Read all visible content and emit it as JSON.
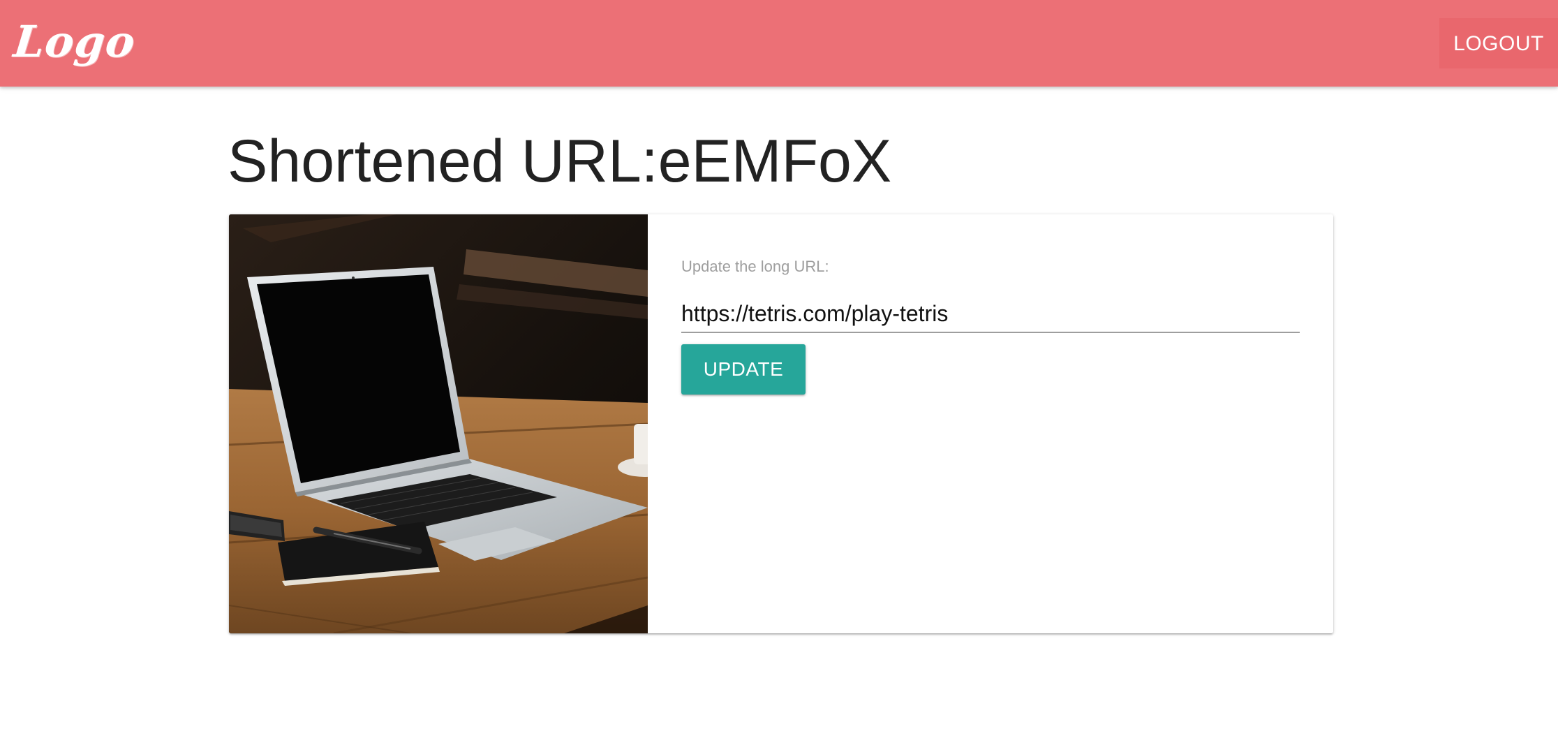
{
  "navbar": {
    "logo_text": "Logo",
    "logout_label": "LOGOUT",
    "bar_color": "#ec7076"
  },
  "page": {
    "title": "Shortened URL:eEMFoX"
  },
  "form": {
    "field_label": "Update the long URL:",
    "long_url_value": "https://tetris.com/play-tetris",
    "update_label": "UPDATE",
    "button_color": "#26a69a"
  },
  "image": {
    "subject": "laptop-on-wooden-table"
  }
}
